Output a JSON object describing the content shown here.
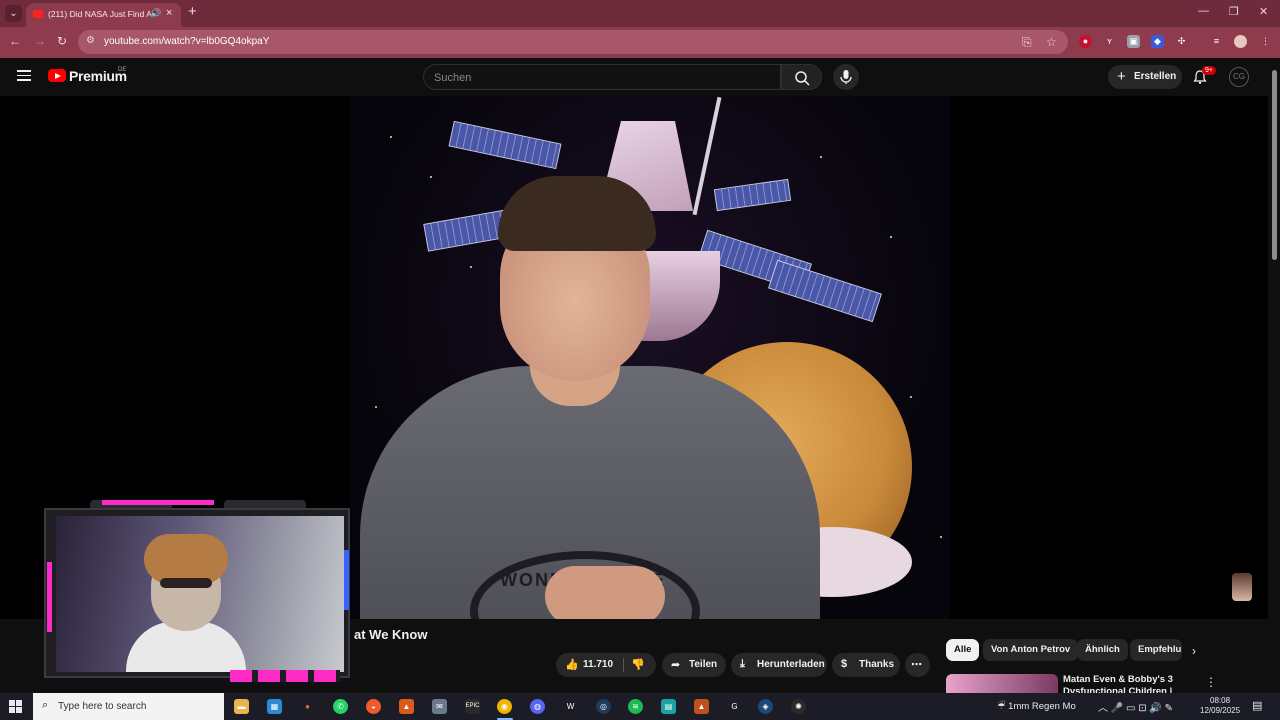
{
  "browser": {
    "tab_title": "(211) Did NASA Just Find A",
    "address": "youtube.com/watch?v=lb0GQ4okpaY",
    "colors": {
      "tabbar": "#6e2b3c",
      "toolbar": "#8e3b4e"
    }
  },
  "youtube": {
    "brand": "Premium",
    "country": "DE",
    "search_placeholder": "Suchen",
    "create_label": "Erstellen",
    "notifications_badge": "9+",
    "account_initials": "CG"
  },
  "video": {
    "title": "at We Know",
    "likes": "11.710",
    "share_label": "Teilen",
    "download_label": "Herunterladen",
    "thanks_label": "Thanks",
    "frame_text": "WONDERSCAPE"
  },
  "sidebar": {
    "chips": [
      "Alle",
      "Von Anton Petrov",
      "Ähnlich",
      "Empfehlu"
    ],
    "recommendation_title": "Matan Even & Bobby's 3 Dysfunctional Children |"
  },
  "taskbar": {
    "search_placeholder": "Type here to search",
    "weather": "1mm Regen Mo",
    "time": "08:08",
    "date": "12/09/2025",
    "icons": [
      "file-explorer-icon",
      "store-icon",
      "firefox-icon",
      "whatsapp-icon",
      "brave-icon",
      "brave-beta-icon",
      "mail-icon",
      "epic-games-icon",
      "chrome-icon",
      "discord-icon",
      "wacom-icon",
      "vpn-icon",
      "spotify-icon",
      "obs-icon",
      "brave-nightly-icon",
      "ghub-icon",
      "steam-icon",
      "chatgpt-icon"
    ]
  }
}
